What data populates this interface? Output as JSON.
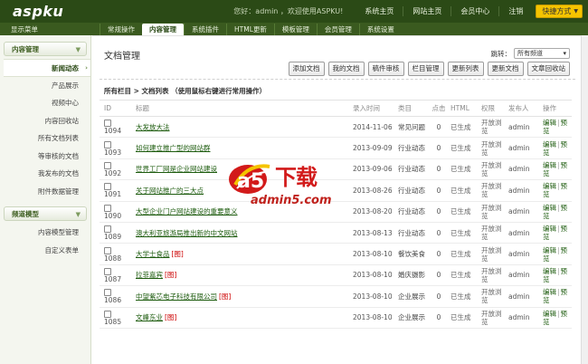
{
  "header": {
    "logo": "aspku",
    "welcome": "您好：admin ，欢迎使用ASPKU!",
    "links": [
      "系统主页",
      "网站主页",
      "会员中心",
      "注销"
    ],
    "quick_label": "快捷方式"
  },
  "nav": {
    "menu_toggle": "显示菜单",
    "tabs": [
      {
        "label": "常规操作",
        "active": false
      },
      {
        "label": "内容管理",
        "active": true
      },
      {
        "label": "系统插件",
        "active": false
      },
      {
        "label": "HTML更新",
        "active": false
      },
      {
        "label": "模板管理",
        "active": false
      },
      {
        "label": "会员管理",
        "active": false
      },
      {
        "label": "系统设置",
        "active": false
      }
    ]
  },
  "sidebar": {
    "groups": [
      {
        "title": "内容管理",
        "items": [
          {
            "label": "新闻动态",
            "active": true
          },
          {
            "label": "产品展示",
            "active": false
          },
          {
            "label": "视频中心",
            "active": false
          },
          {
            "label": "内容回收站",
            "active": false
          },
          {
            "label": "所有文档列表",
            "active": false
          },
          {
            "label": "等审核的文档",
            "active": false
          },
          {
            "label": "我发布的文档",
            "active": false
          },
          {
            "label": "附件数据管理",
            "active": false
          }
        ]
      },
      {
        "title": "频道模型",
        "items": [
          {
            "label": "内容模型管理",
            "active": false
          },
          {
            "label": "自定义表单",
            "active": false
          }
        ]
      }
    ]
  },
  "main": {
    "title": "文档管理",
    "jump_label": "跳转：",
    "jump_value": "所有频道",
    "toolbar": [
      "添加文档",
      "我的文档",
      "稿件审核",
      "栏目管理",
      "更新列表",
      "更新文档",
      "文章回收站"
    ],
    "breadcrumb": "所有栏目 > 文档列表 （使用鼠标右键进行常用操作）",
    "columns": [
      "ID",
      "标题",
      "录入时间",
      "类目",
      "点击",
      "HTML",
      "权限",
      "发布人",
      "操作"
    ],
    "rows": [
      {
        "id": "1094",
        "title": "大发放大法",
        "pic": false,
        "date": "2014-11-06",
        "cat": "常见问题",
        "hits": "0",
        "html": "已生成",
        "perm": "开放浏览",
        "pub": "admin",
        "edit": "编辑",
        "view": "预览"
      },
      {
        "id": "1093",
        "title": "如何建立推广型的网站群",
        "pic": false,
        "date": "2013-09-09",
        "cat": "行业动态",
        "hits": "0",
        "html": "已生成",
        "perm": "开放浏览",
        "pub": "admin",
        "edit": "编辑",
        "view": "预览"
      },
      {
        "id": "1092",
        "title": "世界工厂网是企业网站建设",
        "pic": false,
        "date": "2013-09-06",
        "cat": "行业动态",
        "hits": "0",
        "html": "已生成",
        "perm": "开放浏览",
        "pub": "admin",
        "edit": "编辑",
        "view": "预览"
      },
      {
        "id": "1091",
        "title": "关于网站推广的三大点",
        "pic": false,
        "date": "2013-08-26",
        "cat": "行业动态",
        "hits": "0",
        "html": "已生成",
        "perm": "开放浏览",
        "pub": "admin",
        "edit": "编辑",
        "view": "预览"
      },
      {
        "id": "1090",
        "title": "大型企业门户网站建设的重要意义",
        "pic": false,
        "date": "2013-08-20",
        "cat": "行业动态",
        "hits": "0",
        "html": "已生成",
        "perm": "开放浏览",
        "pub": "admin",
        "edit": "编辑",
        "view": "预览"
      },
      {
        "id": "1089",
        "title": "澳大利亚旅游局推出新的中文网站",
        "pic": false,
        "date": "2013-08-13",
        "cat": "行业动态",
        "hits": "0",
        "html": "已生成",
        "perm": "开放浏览",
        "pub": "admin",
        "edit": "编辑",
        "view": "预览"
      },
      {
        "id": "1088",
        "title": "大学士食品",
        "pic": true,
        "date": "2013-08-10",
        "cat": "餐饮美食",
        "hits": "0",
        "html": "已生成",
        "perm": "开放浏览",
        "pub": "admin",
        "edit": "编辑",
        "view": "预览"
      },
      {
        "id": "1087",
        "title": "拉菲嘉宾",
        "pic": true,
        "date": "2013-08-10",
        "cat": "婚庆摄影",
        "hits": "0",
        "html": "已生成",
        "perm": "开放浏览",
        "pub": "admin",
        "edit": "编辑",
        "view": "预览"
      },
      {
        "id": "1086",
        "title": "中望紫芯电子科技有限公司",
        "pic": true,
        "date": "2013-08-10",
        "cat": "企业展示",
        "hits": "0",
        "html": "已生成",
        "perm": "开放浏览",
        "pub": "admin",
        "edit": "编辑",
        "view": "预览"
      },
      {
        "id": "1085",
        "title": "文峰东业",
        "pic": true,
        "date": "2013-08-10",
        "cat": "企业展示",
        "hits": "0",
        "html": "已生成",
        "perm": "开放浏览",
        "pub": "admin",
        "edit": "编辑",
        "view": "预览"
      }
    ],
    "pic_tag": "[图]",
    "op_sep": "|"
  },
  "watermark": {
    "badge": "a5",
    "text": "下载",
    "url": "admin5.com"
  },
  "colors": {
    "header_bg": "#2b4a16",
    "nav_bg": "#3a5a1f",
    "accent_link": "#1e5c0f",
    "quick_btn": "#f5c400",
    "watermark_red": "#d21a1a"
  }
}
